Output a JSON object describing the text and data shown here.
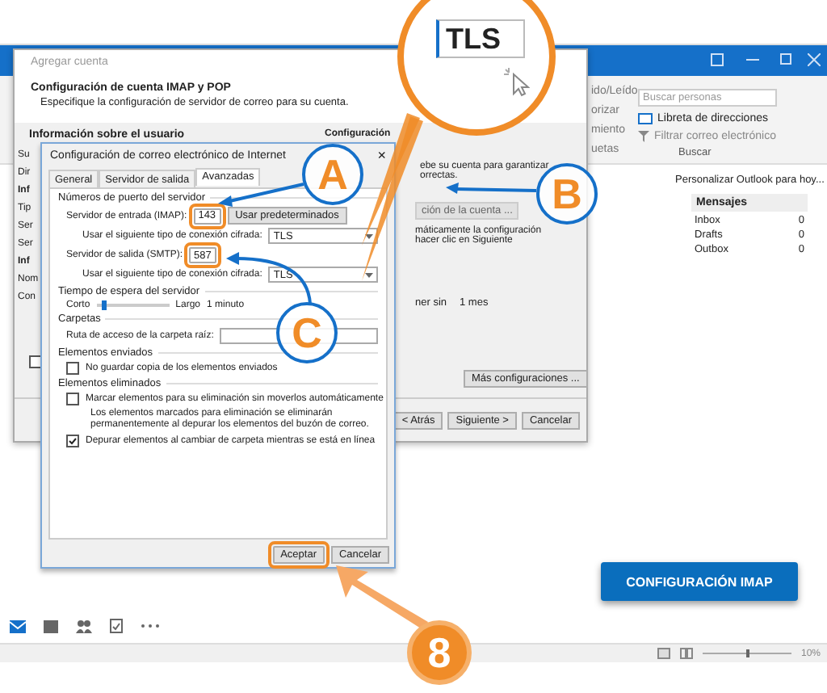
{
  "outlook": {
    "ribbon_partial": [
      "ido/Leído",
      "orizar",
      "miento",
      "uetas"
    ],
    "search_people": {
      "placeholder": "Buscar personas"
    },
    "address_book": "Libreta de direcciones",
    "filter_mail": "Filtrar correo electrónico",
    "group_label": "Buscar",
    "customize": "Personalizar Outlook para hoy...",
    "messages": {
      "title": "Mensajes",
      "rows": [
        {
          "name": "Inbox",
          "count": "0"
        },
        {
          "name": "Drafts",
          "count": "0"
        },
        {
          "name": "Outbox",
          "count": "0"
        }
      ]
    },
    "status_bar": {
      "zoom": {
        "level": 0.5,
        "reading": "10%"
      }
    }
  },
  "add_account": {
    "title": "Agregar cuenta",
    "heading": "Configuración de cuenta IMAP y POP",
    "subtitle": "Especifique la configuración de servidor de correo para su cuenta.",
    "left_section": "Información sobre el usuario",
    "left_labels": [
      {
        "text": "Su",
        "bold": false
      },
      {
        "text": "Dir",
        "bold": false
      },
      {
        "text": "Inf",
        "bold": true
      },
      {
        "text": "Tip",
        "bold": false
      },
      {
        "text": "Ser",
        "bold": false
      },
      {
        "text": "Ser",
        "bold": false
      },
      {
        "text": "Inf",
        "bold": true
      },
      {
        "text": "Nom",
        "bold": false
      },
      {
        "text": "Con",
        "bold": false
      }
    ],
    "right_section": "Configuración",
    "right_text": [
      "ebe su cuenta para garantizar",
      "orrectas."
    ],
    "test_button": "ción de la cuenta ...",
    "auto_text": [
      "máticamente la configuración",
      "hacer clic en Siguiente"
    ],
    "keep_text": "ner sin",
    "keep_value": "1 mes",
    "more_button": "Más configuraciones ...",
    "checkbox": {
      "checked": false
    },
    "buttons": [
      "< Atrás",
      "Siguiente >",
      "Cancelar"
    ]
  },
  "inner_dialog": {
    "title": "Configuración de correo electrónico de Internet",
    "close": "×",
    "tabs": [
      {
        "label": "General",
        "selected": false
      },
      {
        "label": "Servidor de salida",
        "selected": false
      },
      {
        "label": "Avanzadas",
        "selected": true
      }
    ],
    "ports": {
      "title": "Números de puerto del servidor",
      "incoming_label": "Servidor de entrada (IMAP):",
      "incoming_value": "143",
      "defaults_button": "Usar predeterminados",
      "encryption_label": "Usar el siguiente tipo de conexión cifrada:",
      "incoming_encryption": "TLS",
      "outgoing_label": "Servidor de salida (SMTP):",
      "outgoing_value": "587",
      "outgoing_encryption_label": "Usar el siguiente tipo de conexión cifrada:",
      "outgoing_encryption": "TLS"
    },
    "timeout": {
      "title": "Tiempo de espera del servidor",
      "short": "Corto",
      "long": "Largo",
      "level": 0.08,
      "reading": "1 minuto"
    },
    "folders": {
      "title": "Carpetas",
      "root_label": "Ruta de acceso de la carpeta raíz:"
    },
    "sent": {
      "title": "Elementos enviados",
      "items": [
        {
          "kind": "checkbox",
          "label": "No guardar copia de los elementos enviados",
          "checked": false
        }
      ]
    },
    "deleted": {
      "title": "Elementos eliminados",
      "items": [
        {
          "kind": "checkbox",
          "label": "Marcar elementos para su eliminación sin moverlos automáticamente",
          "checked": false
        },
        {
          "kind": "note",
          "label": "Los elementos marcados para eliminación se eliminarán permanentemente al depurar los elementos del buzón de correo."
        },
        {
          "kind": "checkbox",
          "label": "Depurar elementos al cambiar de carpeta mientras se está en línea",
          "checked": true
        }
      ]
    },
    "buttons": [
      "Aceptar",
      "Cancelar"
    ]
  },
  "callouts": {
    "magnifier_text": "TLS",
    "markers": [
      "A",
      "B",
      "C"
    ],
    "step": "8",
    "banner": "CONFIGURACIÓN IMAP"
  }
}
